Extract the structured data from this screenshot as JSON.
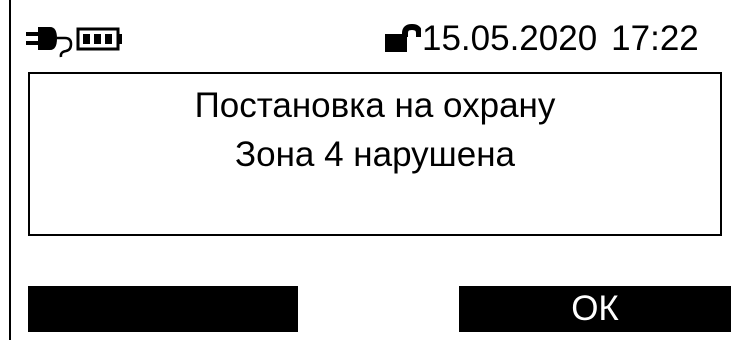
{
  "status_bar": {
    "power_icon": "plug-battery-icon",
    "lock_icon": "lock-icon",
    "date": "15.05.2020",
    "time": "17:22"
  },
  "message": {
    "line1": "Постановка на охрану",
    "line2": "Зона 4 нарушена"
  },
  "softkeys": {
    "left_label": "",
    "right_label": "ОК"
  }
}
